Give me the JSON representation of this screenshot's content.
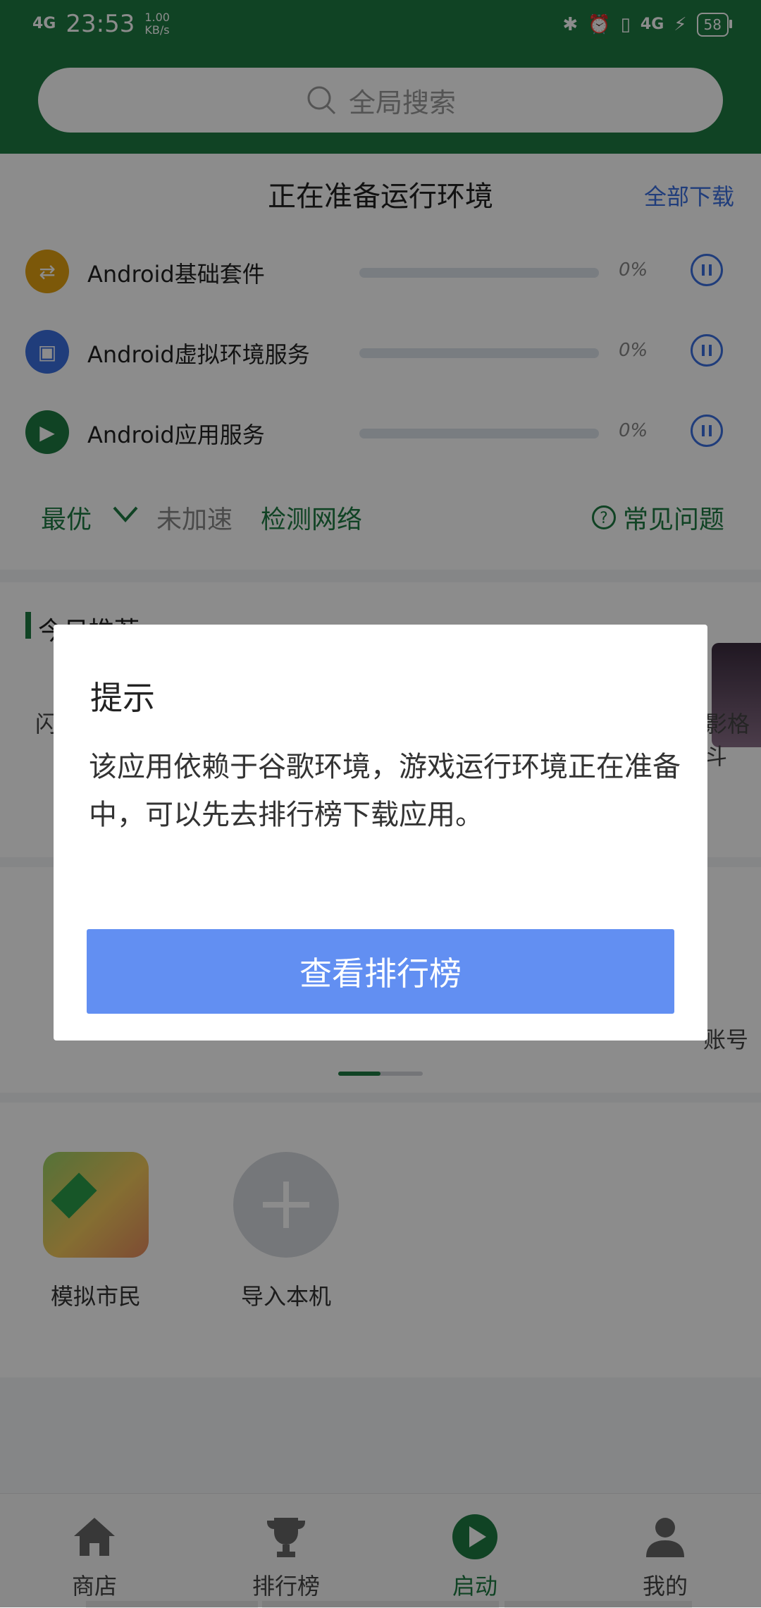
{
  "status_bar": {
    "network": "4G",
    "time": "23:53",
    "speed_value": "1.00",
    "speed_unit": "KB/s",
    "network_right": "4G",
    "battery": "58"
  },
  "search": {
    "placeholder": "全局搜索"
  },
  "prep": {
    "title": "正在准备运行环境",
    "download_all": "全部下载",
    "items": [
      {
        "name": "Android基础套件",
        "progress": "0%",
        "color": "#e2a012",
        "icon": "swap-icon"
      },
      {
        "name": "Android虚拟环境服务",
        "progress": "0%",
        "color": "#3b6fe0",
        "icon": "robot-icon"
      },
      {
        "name": "Android应用服务",
        "progress": "0%",
        "color": "#1e7a43",
        "icon": "play-store-icon"
      }
    ],
    "speed_mode": "最优",
    "accel_status": "未加速",
    "check_network": "检测网络",
    "faq": "常见问题"
  },
  "recommend": {
    "title": "今日推荐",
    "left_fragment": "闪",
    "right_fragment": "影格斗"
  },
  "categories": {
    "right_fragment": "账号"
  },
  "apps": [
    {
      "label": "模拟市民"
    },
    {
      "label": "导入本机"
    }
  ],
  "bottom_nav": [
    {
      "label": "商店",
      "icon": "home-icon"
    },
    {
      "label": "排行榜",
      "icon": "trophy-icon"
    },
    {
      "label": "启动",
      "icon": "play-icon",
      "active": true
    },
    {
      "label": "我的",
      "icon": "person-icon"
    }
  ],
  "dialog": {
    "title": "提示",
    "message": "该应用依赖于谷歌环境，游戏运行环境正在准备中，可以先去排行榜下载应用。",
    "button": "查看排行榜"
  },
  "colors": {
    "brand_green": "#1e7a43",
    "link_blue": "#3b6fe0",
    "dialog_button": "#628ff2"
  }
}
